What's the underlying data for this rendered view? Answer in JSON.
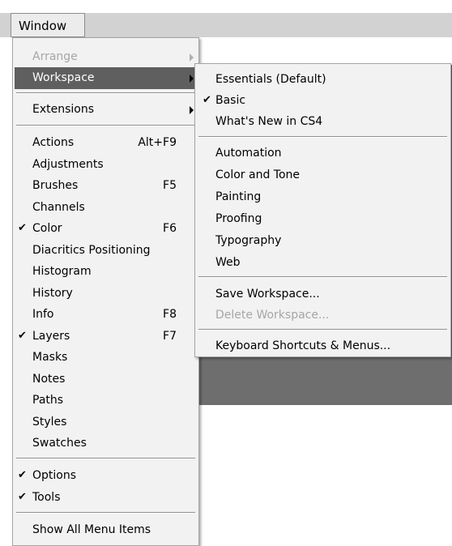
{
  "menubar": {
    "window_label": "Window"
  },
  "main_menu": {
    "items": [
      {
        "label": "Arrange",
        "disabled": true,
        "submenu": true
      },
      {
        "label": "Workspace",
        "highlighted": true,
        "submenu": true
      },
      {
        "label": "Extensions",
        "submenu": true
      },
      {
        "label": "Actions",
        "shortcut": "Alt+F9"
      },
      {
        "label": "Adjustments"
      },
      {
        "label": "Brushes",
        "shortcut": "F5"
      },
      {
        "label": "Channels"
      },
      {
        "label": "Color",
        "checked": true,
        "shortcut": "F6"
      },
      {
        "label": "Diacritics Positioning"
      },
      {
        "label": "Histogram"
      },
      {
        "label": "History"
      },
      {
        "label": "Info",
        "shortcut": "F8"
      },
      {
        "label": "Layers",
        "checked": true,
        "shortcut": "F7"
      },
      {
        "label": "Masks"
      },
      {
        "label": "Notes"
      },
      {
        "label": "Paths"
      },
      {
        "label": "Styles"
      },
      {
        "label": "Swatches"
      },
      {
        "label": "Options",
        "checked": true
      },
      {
        "label": "Tools",
        "checked": true
      },
      {
        "label": "Show All Menu Items"
      }
    ]
  },
  "workspace_submenu": {
    "items": [
      {
        "label": "Essentials (Default)"
      },
      {
        "label": "Basic",
        "checked": true
      },
      {
        "label": "What's New in CS4"
      },
      {
        "label": "Automation"
      },
      {
        "label": "Color and Tone"
      },
      {
        "label": "Painting"
      },
      {
        "label": "Proofing"
      },
      {
        "label": "Typography"
      },
      {
        "label": "Web"
      },
      {
        "label": "Save Workspace..."
      },
      {
        "label": "Delete Workspace...",
        "disabled": true
      },
      {
        "label": "Keyboard Shortcuts & Menus..."
      }
    ]
  },
  "symbols": {
    "check": "✔"
  },
  "icons": {
    "check": "checkmark-icon",
    "submenu": "submenu-arrow-icon"
  },
  "colors": {
    "highlight": "#5f5f5f",
    "menu_bg": "#f2f2f2",
    "disabled_text": "#a6a6a6"
  }
}
